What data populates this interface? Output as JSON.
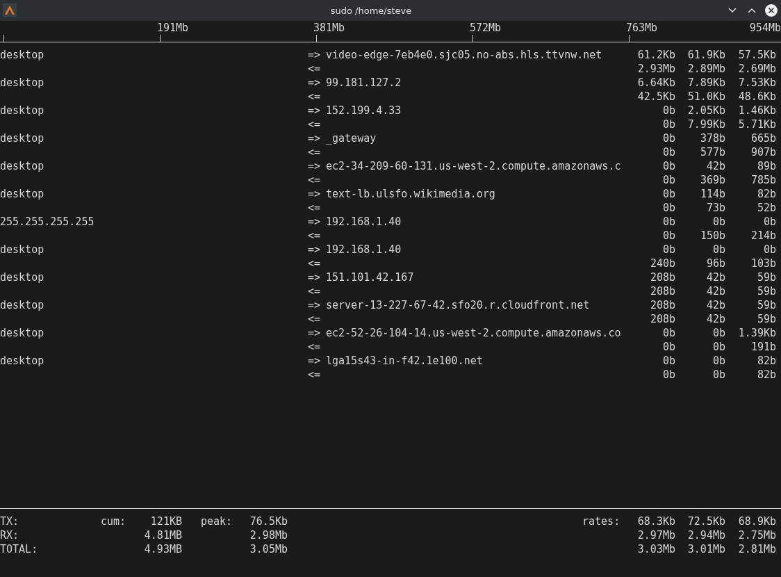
{
  "window": {
    "title": "sudo /home/steve"
  },
  "scale": [
    "191Mb",
    "381Mb",
    "572Mb",
    "763Mb",
    "954Mb"
  ],
  "flows": [
    {
      "host": "desktop",
      "out": {
        "arrow": "=>",
        "remote": "video-edge-7eb4e0.sjc05.no-abs.hls.ttvnw.net",
        "rates": [
          "61.2Kb",
          "61.9Kb",
          "57.5Kb"
        ]
      },
      "in": {
        "arrow": "<=",
        "rates": [
          "2.93Mb",
          "2.89Mb",
          "2.69Mb"
        ]
      }
    },
    {
      "host": "desktop",
      "out": {
        "arrow": "=>",
        "remote": "99.181.127.2",
        "rates": [
          "6.64Kb",
          "7.89Kb",
          "7.53Kb"
        ]
      },
      "in": {
        "arrow": "<=",
        "rates": [
          "42.5Kb",
          "51.0Kb",
          "48.6Kb"
        ]
      }
    },
    {
      "host": "desktop",
      "out": {
        "arrow": "=>",
        "remote": "152.199.4.33",
        "rates": [
          "0b",
          "2.05Kb",
          "1.46Kb"
        ]
      },
      "in": {
        "arrow": "<=",
        "rates": [
          "0b",
          "7.99Kb",
          "5.71Kb"
        ]
      }
    },
    {
      "host": "desktop",
      "out": {
        "arrow": "=>",
        "remote": "_gateway",
        "rates": [
          "0b",
          "378b",
          "665b"
        ]
      },
      "in": {
        "arrow": "<=",
        "rates": [
          "0b",
          "577b",
          "907b"
        ]
      }
    },
    {
      "host": "desktop",
      "out": {
        "arrow": "=>",
        "remote": "ec2-34-209-60-131.us-west-2.compute.amazonaws.c",
        "rates": [
          "0b",
          "42b",
          "89b"
        ]
      },
      "in": {
        "arrow": "<=",
        "rates": [
          "0b",
          "369b",
          "785b"
        ]
      }
    },
    {
      "host": "desktop",
      "out": {
        "arrow": "=>",
        "remote": "text-lb.ulsfo.wikimedia.org",
        "rates": [
          "0b",
          "114b",
          "82b"
        ]
      },
      "in": {
        "arrow": "<=",
        "rates": [
          "0b",
          "73b",
          "52b"
        ]
      }
    },
    {
      "host": "255.255.255.255",
      "out": {
        "arrow": "=>",
        "remote": "192.168.1.40",
        "rates": [
          "0b",
          "0b",
          "0b"
        ]
      },
      "in": {
        "arrow": "<=",
        "rates": [
          "0b",
          "150b",
          "214b"
        ]
      }
    },
    {
      "host": "desktop",
      "out": {
        "arrow": "=>",
        "remote": "192.168.1.40",
        "rates": [
          "0b",
          "0b",
          "0b"
        ]
      },
      "in": {
        "arrow": "<=",
        "rates": [
          "240b",
          "96b",
          "103b"
        ]
      }
    },
    {
      "host": "desktop",
      "out": {
        "arrow": "=>",
        "remote": "151.101.42.167",
        "rates": [
          "208b",
          "42b",
          "59b"
        ]
      },
      "in": {
        "arrow": "<=",
        "rates": [
          "208b",
          "42b",
          "59b"
        ]
      }
    },
    {
      "host": "desktop",
      "out": {
        "arrow": "=>",
        "remote": "server-13-227-67-42.sfo20.r.cloudfront.net",
        "rates": [
          "208b",
          "42b",
          "59b"
        ]
      },
      "in": {
        "arrow": "<=",
        "rates": [
          "208b",
          "42b",
          "59b"
        ]
      }
    },
    {
      "host": "desktop",
      "out": {
        "arrow": "=>",
        "remote": "ec2-52-26-104-14.us-west-2.compute.amazonaws.co",
        "rates": [
          "0b",
          "0b",
          "1.39Kb"
        ]
      },
      "in": {
        "arrow": "<=",
        "rates": [
          "0b",
          "0b",
          "191b"
        ]
      }
    },
    {
      "host": "desktop",
      "out": {
        "arrow": "=>",
        "remote": "lga15s43-in-f42.1e100.net",
        "rates": [
          "0b",
          "0b",
          "82b"
        ]
      },
      "in": {
        "arrow": "<=",
        "rates": [
          "0b",
          "0b",
          "82b"
        ]
      }
    }
  ],
  "totals": [
    {
      "label": "TX:",
      "cum_label": "cum:",
      "cum": "121KB",
      "peak_label": "peak:",
      "peak": "76.5Kb",
      "rates_label": "rates:",
      "rates": [
        "68.3Kb",
        "72.5Kb",
        "68.9Kb"
      ]
    },
    {
      "label": "RX:",
      "cum": "4.81MB",
      "peak": "2.98Mb",
      "rates": [
        "2.97Mb",
        "2.94Mb",
        "2.75Mb"
      ]
    },
    {
      "label": "TOTAL:",
      "cum": "4.93MB",
      "peak": "3.05Mb",
      "rates": [
        "3.03Mb",
        "3.01Mb",
        "2.81Mb"
      ]
    }
  ]
}
